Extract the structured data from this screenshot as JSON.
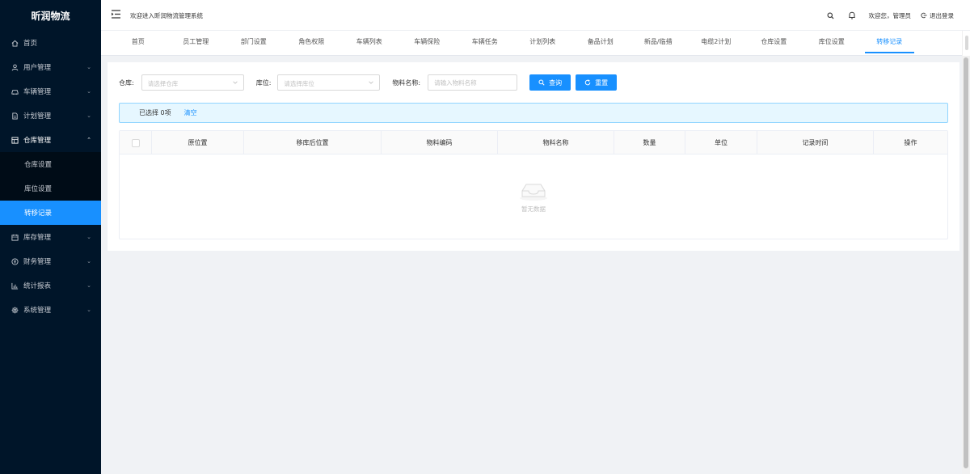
{
  "app": {
    "logo": "昕润物流"
  },
  "header": {
    "welcome": "欢迎进入昕润物流管理系统",
    "user_greeting": "欢迎您，管理员",
    "logout": "退出登录"
  },
  "sidebar": {
    "items": [
      {
        "label": "首页",
        "icon": "home-icon",
        "expandable": false
      },
      {
        "label": "用户管理",
        "icon": "user-icon",
        "expandable": true
      },
      {
        "label": "车辆管理",
        "icon": "car-icon",
        "expandable": true
      },
      {
        "label": "计划管理",
        "icon": "document-icon",
        "expandable": true
      },
      {
        "label": "仓库管理",
        "icon": "warehouse-icon",
        "expandable": true,
        "open": true
      },
      {
        "label": "库存管理",
        "icon": "calendar-icon",
        "expandable": true
      },
      {
        "label": "财务管理",
        "icon": "money-icon",
        "expandable": true
      },
      {
        "label": "统计报表",
        "icon": "bar-chart-icon",
        "expandable": true
      },
      {
        "label": "系统管理",
        "icon": "settings-icon",
        "expandable": true
      }
    ],
    "submenu": [
      {
        "label": "仓库设置"
      },
      {
        "label": "库位设置"
      },
      {
        "label": "转移记录",
        "active": true
      }
    ]
  },
  "tabs": [
    "首页",
    "员工管理",
    "部门设置",
    "角色权限",
    "车辆列表",
    "车辆保险",
    "车辆任务",
    "计划列表",
    "备品计划",
    "新品/临措",
    "电缆2计划",
    "仓库设置",
    "库位设置",
    "转移记录"
  ],
  "active_tab": "转移记录",
  "search": {
    "warehouse_label": "仓库:",
    "warehouse_placeholder": "请选择仓库",
    "location_label": "库位:",
    "location_placeholder": "请选择库位",
    "material_label": "物料名称:",
    "material_placeholder": "请输入物料名称",
    "query_button": "查询",
    "reset_button": "重置"
  },
  "selection": {
    "count_text": "已选择 0项",
    "clear_link": "清空"
  },
  "table": {
    "columns": [
      "原位置",
      "移库后位置",
      "物料编码",
      "物料名称",
      "数量",
      "单位",
      "记录时间",
      "操作"
    ],
    "empty_text": "暂无数据"
  },
  "colors": {
    "sidebar_bg": "#001529",
    "accent": "#1890ff",
    "alert_bg": "#e6f7ff"
  }
}
